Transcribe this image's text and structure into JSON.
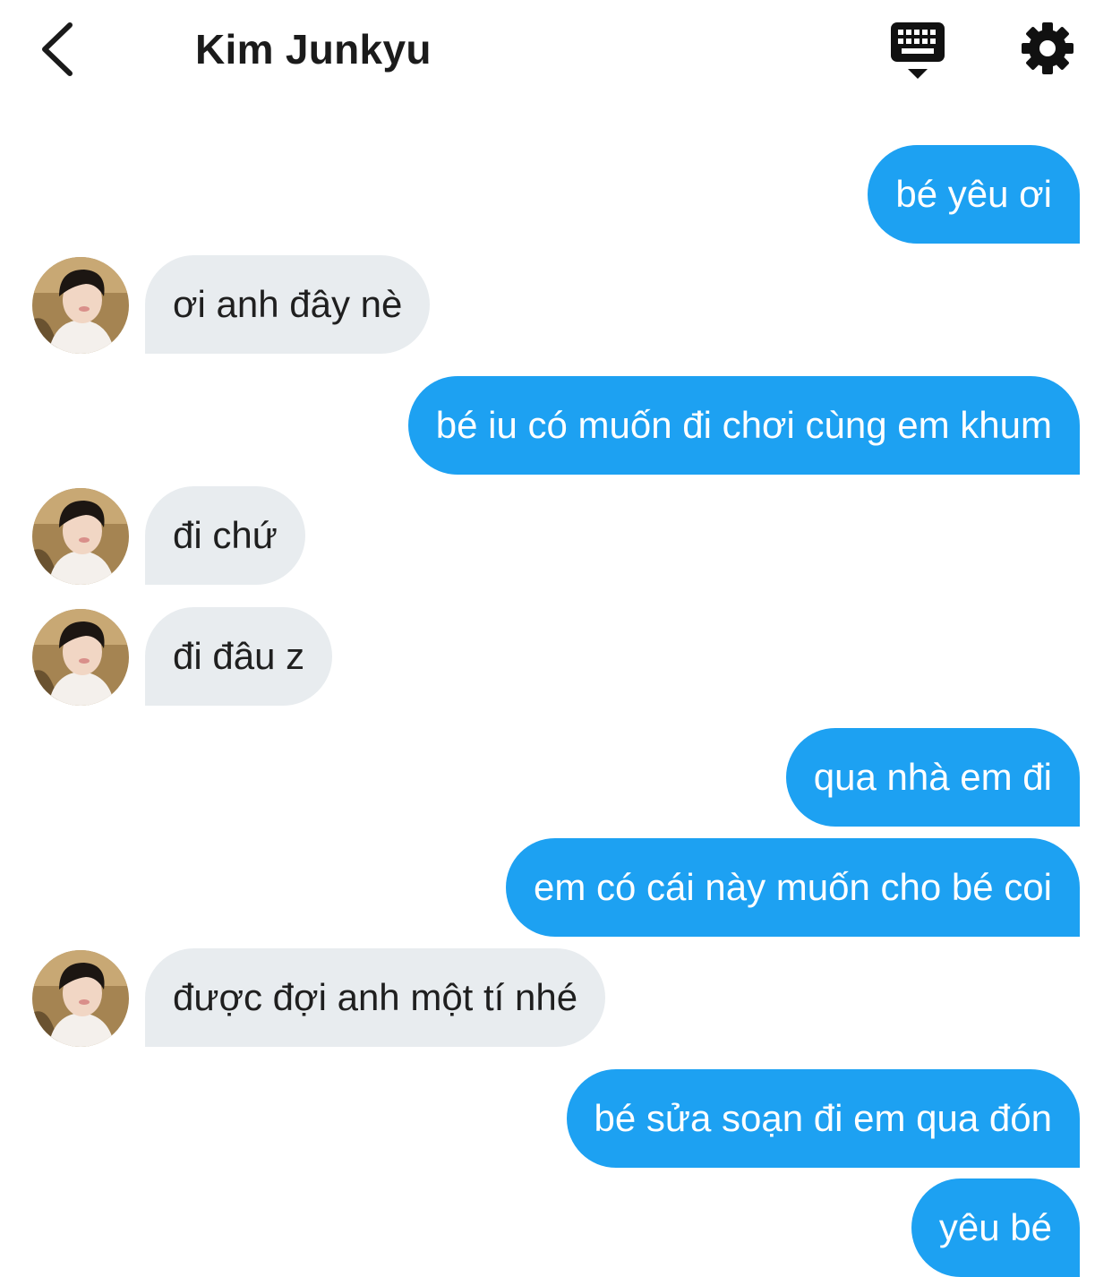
{
  "header": {
    "title": "Kim Junkyu",
    "back_icon": "chevron-left-icon",
    "keyboard_icon": "keyboard-icon",
    "settings_icon": "gear-icon"
  },
  "colors": {
    "sent_bubble": "#1da1f2",
    "received_bubble": "#e8ecef",
    "background": "#ffffff"
  },
  "messages": [
    {
      "from": "me",
      "text": "bé yêu ơi"
    },
    {
      "from": "them",
      "text": "ơi anh đây nè"
    },
    {
      "from": "me",
      "text": "bé iu có muốn đi chơi cùng em khum"
    },
    {
      "from": "them",
      "text": "đi chứ"
    },
    {
      "from": "them",
      "text": "đi đâu z"
    },
    {
      "from": "me",
      "text": "qua nhà em đi"
    },
    {
      "from": "me",
      "text": "em có cái này muốn cho bé coi"
    },
    {
      "from": "them",
      "text": "được đợi anh một tí nhé"
    },
    {
      "from": "me",
      "text": "bé sửa soạn đi em qua đón"
    },
    {
      "from": "me",
      "text": "yêu bé"
    }
  ]
}
